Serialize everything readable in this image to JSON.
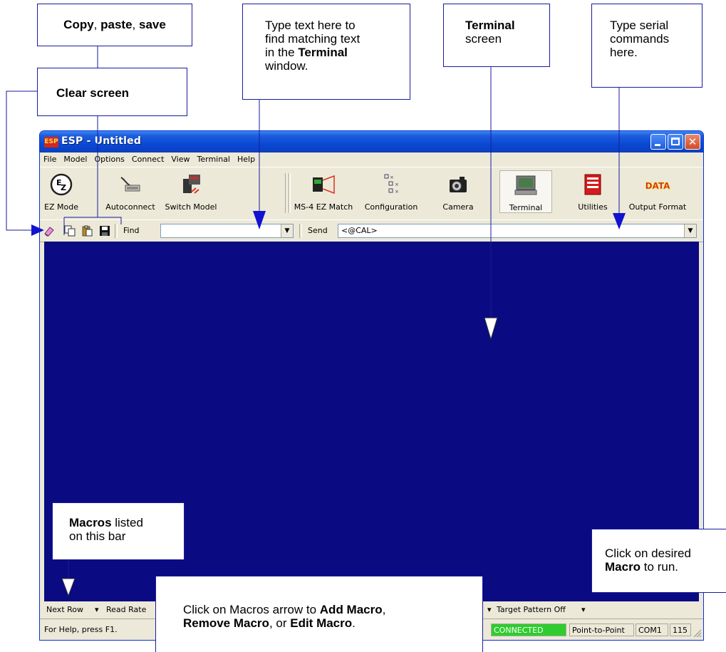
{
  "window": {
    "title": "ESP - Untitled",
    "app_icon_text": "ESP",
    "menu": [
      "File",
      "Model",
      "Options",
      "Connect",
      "View",
      "Terminal",
      "Help"
    ]
  },
  "toolbar": {
    "buttons": [
      {
        "label": "EZ Mode",
        "icon": "ez-mode-icon"
      },
      {
        "label": "Autoconnect",
        "icon": "cable-icon"
      },
      {
        "label": "Switch Model",
        "icon": "reader-model-icon"
      },
      {
        "label": "MS-4 EZ Match",
        "icon": "scanner-icon"
      },
      {
        "label": "Configuration",
        "icon": "tree-config-icon"
      },
      {
        "label": "Camera",
        "icon": "camera-icon"
      },
      {
        "label": "Terminal",
        "icon": "terminal-icon",
        "selected": true
      },
      {
        "label": "Utilities",
        "icon": "toolbox-icon"
      },
      {
        "label": "Output Format",
        "icon": "data-icon"
      }
    ],
    "data_icon_text": "DATA"
  },
  "findbar": {
    "find_label": "Find",
    "find_value": "",
    "send_label": "Send",
    "send_value": "<@CAL>"
  },
  "macrobar": {
    "items": [
      "Next Row",
      "Read Rate",
      "Target Pattern Off"
    ]
  },
  "statusbar": {
    "help_text": "For Help, press F1.",
    "connection_status": "CONNECTED",
    "mode": "Point-to-Point",
    "port": "COM1",
    "baud_partial": "115"
  },
  "callouts": {
    "copy_paste_save": [
      "Copy",
      ", ",
      "paste",
      ", ",
      "save"
    ],
    "clear_screen": "Clear screen",
    "find": {
      "line1": "Type text here to",
      "line2": "find matching text",
      "line3_pre": "in the ",
      "line3_bold": "Terminal",
      "line4": "window."
    },
    "terminal": {
      "bold": "Terminal",
      "line2": "screen"
    },
    "serial": {
      "line1": "Type serial",
      "line2": "commands",
      "line3": "here."
    },
    "macros_bar": {
      "bold": "Macros",
      "rest1": " listed",
      "line2": "on this bar"
    },
    "run_macro": {
      "line1": "Click on desired",
      "bold": "Macro",
      "rest": " to run."
    },
    "macros_arrow": {
      "pre": "Click on Macros arrow to ",
      "add": "Add Macro",
      "c1": ",",
      "remove": "Remove Macro",
      "mid": ", or ",
      "edit": "Edit Macro",
      "end": "."
    }
  },
  "colors": {
    "terminal_bg": "#0a0a82",
    "connected_bg": "#2ecc2e",
    "callout_line": "#1a1aa0"
  }
}
